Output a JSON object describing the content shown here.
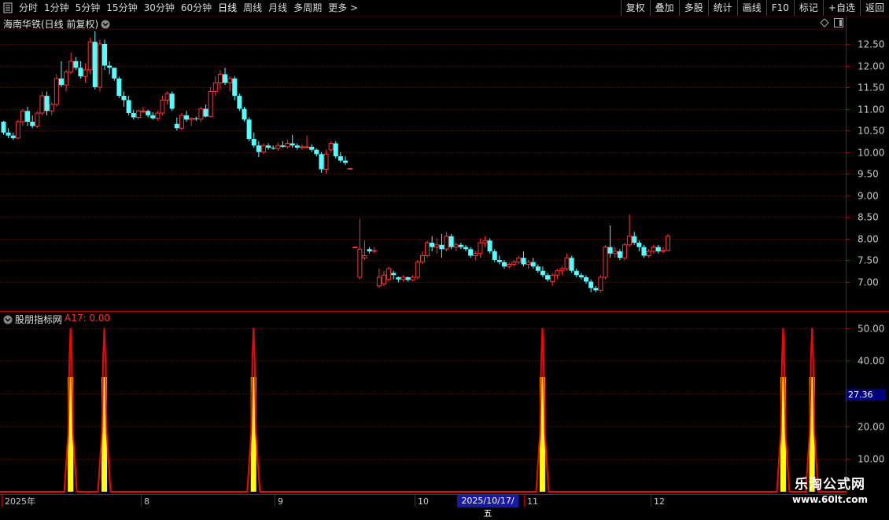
{
  "toolbar": {
    "menu_icon": "menu-icon",
    "periods": [
      "分时",
      "1分钟",
      "5分钟",
      "15分钟",
      "30分钟",
      "60分钟",
      "日线",
      "周线",
      "月线",
      "多周期",
      "更多 >"
    ],
    "active_period": "日线",
    "right_buttons": [
      "复权",
      "叠加",
      "多股",
      "统计",
      "画线",
      "F10",
      "标记",
      "+自选",
      "返回"
    ]
  },
  "main_chart": {
    "title": "海南华铁(日线 前复权)",
    "title_icon": "chevron-down-circle-icon",
    "window_controls": [
      "diamond-icon",
      "panel-toggle-icon"
    ],
    "price_ticks": [
      "12.50",
      "12.00",
      "11.50",
      "11.00",
      "10.50",
      "10.00",
      "9.50",
      "9.00",
      "8.50",
      "8.00",
      "7.50",
      "7.00"
    ],
    "up_color": "#ff3232",
    "down_color": "#54ffff"
  },
  "indicator": {
    "title": "股朋指标网",
    "value_label": "A17: 0.00",
    "ticks": [
      "50.00",
      "40.00",
      "30.00",
      "20.00",
      "10.00"
    ],
    "current_value": "27.36",
    "line_color": "#ff0000",
    "bar_color": "#ffff00"
  },
  "x_axis": {
    "labels": [
      "2025年",
      "8",
      "9",
      "10",
      "11",
      "12"
    ],
    "highlight_date": "2025/10/17/五"
  },
  "watermark": {
    "title": "乐淘公式网",
    "url": "www.60lt.com"
  },
  "chart_data": {
    "type": "candlestick",
    "title": "海南华铁(日线 前复权)",
    "price_axis_range": [
      6.5,
      12.85
    ],
    "ohlc": [
      [
        10.7,
        10.72,
        10.4,
        10.45
      ],
      [
        10.45,
        10.55,
        10.32,
        10.38
      ],
      [
        10.38,
        10.45,
        10.28,
        10.32
      ],
      [
        10.32,
        10.75,
        10.3,
        10.7
      ],
      [
        10.7,
        11.0,
        10.6,
        10.95
      ],
      [
        10.95,
        11.05,
        10.6,
        10.7
      ],
      [
        10.7,
        10.85,
        10.55,
        10.6
      ],
      [
        10.6,
        10.95,
        10.55,
        10.9
      ],
      [
        10.9,
        11.4,
        10.85,
        11.3
      ],
      [
        11.3,
        11.4,
        10.85,
        10.95
      ],
      [
        10.95,
        11.15,
        10.85,
        11.1
      ],
      [
        11.1,
        11.8,
        11.05,
        11.7
      ],
      [
        11.7,
        12.1,
        11.5,
        11.55
      ],
      [
        11.55,
        11.9,
        11.4,
        11.85
      ],
      [
        11.85,
        12.3,
        11.8,
        12.1
      ],
      [
        12.1,
        12.2,
        11.9,
        11.95
      ],
      [
        11.95,
        12.1,
        11.7,
        11.75
      ],
      [
        11.75,
        12.05,
        11.6,
        11.9
      ],
      [
        11.9,
        12.65,
        11.8,
        12.55
      ],
      [
        12.55,
        12.8,
        11.45,
        11.5
      ],
      [
        11.5,
        12.6,
        11.4,
        12.5
      ],
      [
        12.5,
        12.6,
        11.9,
        12.0
      ],
      [
        12.0,
        12.1,
        11.8,
        11.95
      ],
      [
        11.95,
        11.95,
        11.65,
        11.7
      ],
      [
        11.7,
        11.75,
        11.25,
        11.3
      ],
      [
        11.3,
        11.4,
        11.05,
        11.2
      ],
      [
        11.2,
        11.3,
        10.85,
        10.9
      ],
      [
        10.9,
        10.98,
        10.75,
        10.8
      ],
      [
        10.8,
        10.98,
        10.75,
        10.95
      ],
      [
        10.95,
        11.05,
        10.9,
        10.95
      ],
      [
        10.95,
        10.98,
        10.8,
        10.85
      ],
      [
        10.85,
        10.92,
        10.75,
        10.78
      ],
      [
        10.78,
        10.95,
        10.72,
        10.9
      ],
      [
        10.9,
        11.3,
        10.85,
        11.2
      ],
      [
        11.2,
        11.4,
        11.1,
        11.35
      ],
      [
        11.35,
        11.4,
        10.95,
        11.0
      ],
      [
        10.65,
        10.8,
        10.5,
        10.55
      ],
      [
        10.55,
        10.9,
        10.5,
        10.85
      ],
      [
        10.85,
        10.95,
        10.7,
        10.75
      ],
      [
        10.75,
        10.8,
        10.6,
        10.78
      ],
      [
        10.78,
        10.82,
        10.72,
        10.76
      ],
      [
        10.76,
        11.05,
        10.7,
        11.0
      ],
      [
        11.0,
        11.1,
        10.8,
        10.82
      ],
      [
        10.82,
        11.5,
        10.8,
        11.4
      ],
      [
        11.4,
        11.75,
        11.3,
        11.6
      ],
      [
        11.6,
        11.9,
        11.45,
        11.8
      ],
      [
        11.8,
        11.95,
        11.55,
        11.6
      ],
      [
        11.6,
        11.75,
        11.4,
        11.7
      ],
      [
        11.7,
        11.75,
        11.2,
        11.3
      ],
      [
        11.3,
        11.35,
        10.95,
        11.0
      ],
      [
        11.0,
        11.05,
        10.7,
        10.75
      ],
      [
        10.75,
        10.8,
        10.25,
        10.3
      ],
      [
        10.3,
        10.45,
        10.1,
        10.15
      ],
      [
        10.15,
        10.25,
        9.88,
        10.0
      ],
      [
        10.0,
        10.2,
        9.95,
        10.15
      ],
      [
        10.15,
        10.2,
        10.05,
        10.1
      ],
      [
        10.1,
        10.15,
        10.05,
        10.08
      ],
      [
        10.08,
        10.22,
        10.02,
        10.15
      ],
      [
        10.15,
        10.25,
        10.1,
        10.12
      ],
      [
        10.12,
        10.28,
        10.08,
        10.2
      ],
      [
        10.2,
        10.4,
        10.1,
        10.15
      ],
      [
        10.15,
        10.2,
        10.05,
        10.1
      ],
      [
        10.1,
        10.18,
        10.05,
        10.12
      ],
      [
        10.12,
        10.38,
        10.08,
        10.12
      ],
      [
        10.12,
        10.18,
        10.0,
        10.05
      ],
      [
        10.05,
        10.08,
        9.9,
        9.95
      ],
      [
        9.95,
        10.0,
        9.52,
        9.6
      ],
      [
        9.6,
        10.05,
        9.5,
        9.95
      ],
      [
        10.05,
        10.25,
        10.0,
        10.2
      ],
      [
        10.2,
        10.25,
        9.85,
        9.9
      ],
      [
        9.9,
        10.0,
        9.75,
        9.8
      ],
      [
        9.8,
        9.9,
        9.7,
        9.75
      ],
      [
        9.62,
        9.62,
        9.62,
        9.62
      ],
      [
        7.8,
        7.8,
        7.8,
        7.8
      ],
      [
        7.1,
        8.45,
        7.05,
        7.75
      ],
      [
        7.55,
        7.95,
        7.5,
        7.6
      ],
      [
        7.75,
        7.8,
        7.65,
        7.7
      ],
      [
        7.7,
        7.8,
        7.65,
        7.72
      ],
      [
        6.9,
        7.3,
        6.85,
        7.1
      ],
      [
        6.95,
        7.25,
        6.9,
        7.15
      ],
      [
        7.05,
        7.35,
        7.0,
        7.3
      ],
      [
        7.2,
        7.25,
        7.05,
        7.15
      ],
      [
        7.1,
        7.12,
        6.98,
        7.05
      ],
      [
        7.05,
        7.15,
        7.0,
        7.1
      ],
      [
        7.1,
        7.12,
        7.0,
        7.04
      ],
      [
        7.04,
        7.15,
        7.0,
        7.1
      ],
      [
        7.1,
        7.5,
        7.05,
        7.45
      ],
      [
        7.45,
        7.7,
        7.4,
        7.6
      ],
      [
        7.6,
        7.95,
        7.55,
        7.9
      ],
      [
        7.9,
        8.05,
        7.7,
        7.8
      ],
      [
        7.8,
        8.0,
        7.65,
        7.85
      ],
      [
        7.85,
        8.1,
        7.55,
        7.75
      ],
      [
        7.75,
        8.15,
        7.7,
        8.05
      ],
      [
        8.05,
        8.1,
        7.75,
        7.8
      ],
      [
        7.8,
        7.9,
        7.7,
        7.85
      ],
      [
        7.85,
        7.9,
        7.75,
        7.8
      ],
      [
        7.8,
        7.85,
        7.7,
        7.75
      ],
      [
        7.75,
        7.8,
        7.55,
        7.6
      ],
      [
        7.6,
        7.7,
        7.5,
        7.65
      ],
      [
        7.65,
        8.0,
        7.55,
        7.9
      ],
      [
        7.9,
        8.05,
        7.8,
        7.95
      ],
      [
        7.95,
        8.0,
        7.65,
        7.7
      ],
      [
        7.7,
        7.75,
        7.45,
        7.5
      ],
      [
        7.5,
        7.6,
        7.4,
        7.45
      ],
      [
        7.45,
        7.5,
        7.3,
        7.35
      ],
      [
        7.35,
        7.45,
        7.3,
        7.4
      ],
      [
        7.4,
        7.5,
        7.35,
        7.45
      ],
      [
        7.45,
        7.6,
        7.4,
        7.55
      ],
      [
        7.55,
        7.7,
        7.35,
        7.4
      ],
      [
        7.4,
        7.5,
        7.3,
        7.45
      ],
      [
        7.45,
        7.55,
        7.3,
        7.35
      ],
      [
        7.35,
        7.4,
        7.2,
        7.25
      ],
      [
        7.25,
        7.35,
        7.1,
        7.15
      ],
      [
        7.15,
        7.2,
        7.0,
        7.05
      ],
      [
        7.0,
        7.2,
        6.9,
        7.15
      ],
      [
        7.15,
        7.3,
        7.05,
        7.25
      ],
      [
        7.25,
        7.35,
        7.15,
        7.3
      ],
      [
        7.3,
        7.65,
        7.25,
        7.55
      ],
      [
        7.55,
        7.6,
        7.2,
        7.25
      ],
      [
        7.25,
        7.3,
        7.1,
        7.15
      ],
      [
        7.15,
        7.2,
        7.05,
        7.1
      ],
      [
        7.1,
        7.15,
        6.95,
        7.0
      ],
      [
        7.0,
        7.05,
        6.75,
        6.85
      ],
      [
        6.85,
        6.9,
        6.75,
        6.8
      ],
      [
        6.8,
        7.15,
        6.75,
        7.1
      ],
      [
        7.1,
        7.85,
        7.05,
        7.8
      ],
      [
        7.8,
        8.3,
        7.55,
        7.65
      ],
      [
        7.65,
        7.8,
        7.55,
        7.7
      ],
      [
        7.7,
        7.75,
        7.5,
        7.55
      ],
      [
        7.55,
        7.9,
        7.5,
        7.85
      ],
      [
        7.85,
        8.55,
        7.8,
        8.05
      ],
      [
        8.05,
        8.15,
        7.85,
        7.9
      ],
      [
        7.9,
        7.95,
        7.7,
        7.8
      ],
      [
        7.8,
        7.85,
        7.55,
        7.6
      ],
      [
        7.6,
        7.75,
        7.55,
        7.7
      ],
      [
        7.7,
        7.85,
        7.65,
        7.8
      ],
      [
        7.8,
        7.85,
        7.65,
        7.7
      ],
      [
        7.7,
        7.8,
        7.65,
        7.72
      ],
      [
        7.72,
        8.1,
        7.7,
        8.05
      ]
    ],
    "indicator_signals": [
      {
        "index": 14,
        "peak": 50,
        "bar": 35
      },
      {
        "index": 21,
        "peak": 50,
        "bar": 35
      },
      {
        "index": 52,
        "peak": 50,
        "bar": 35
      },
      {
        "index": 112,
        "peak": 50,
        "bar": 35
      },
      {
        "index": 162,
        "peak": 50,
        "bar": 35
      },
      {
        "index": 168,
        "peak": 50,
        "bar": 35
      }
    ],
    "indicator_range": [
      0,
      52
    ]
  }
}
